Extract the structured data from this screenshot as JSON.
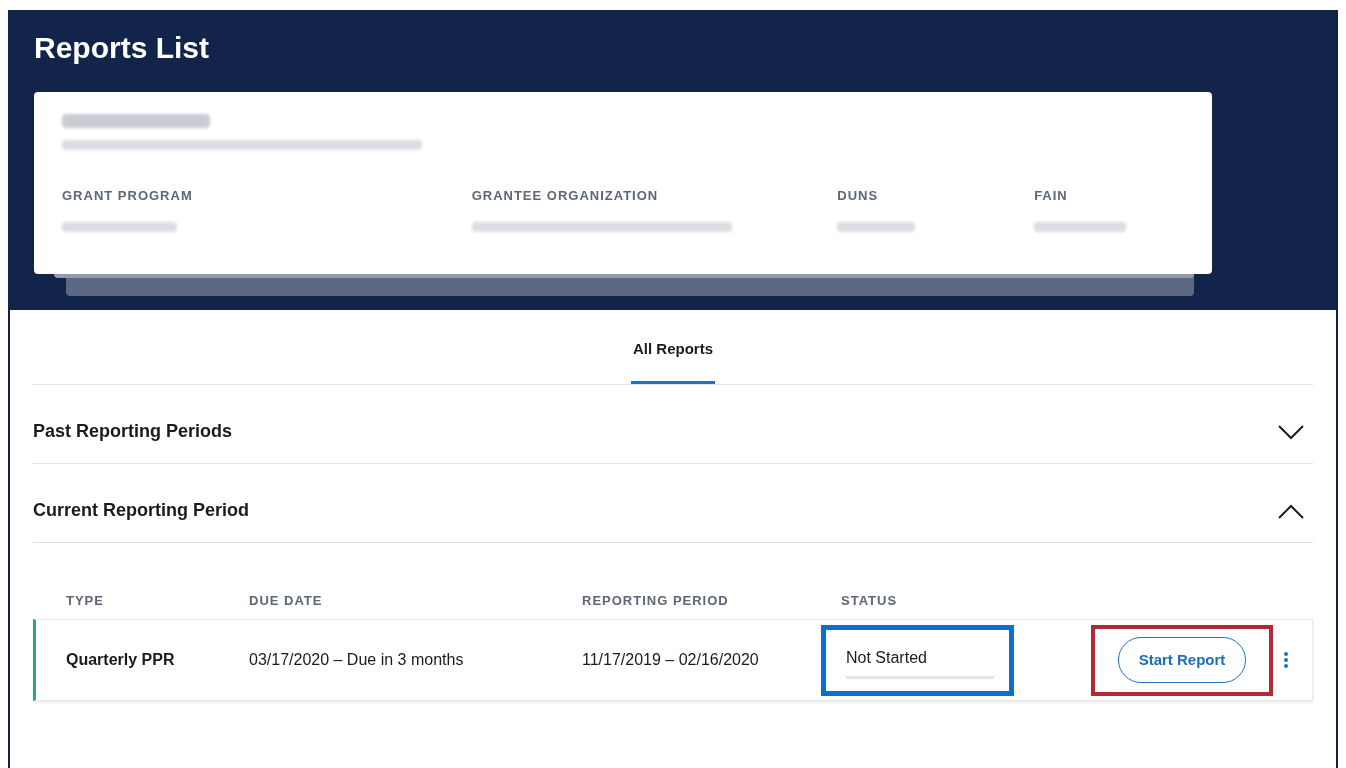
{
  "page": {
    "title": "Reports List"
  },
  "grant_card": {
    "fields": [
      {
        "label": "GRANT PROGRAM"
      },
      {
        "label": "GRANTEE ORGANIZATION"
      },
      {
        "label": "DUNS"
      },
      {
        "label": "FAIN"
      }
    ]
  },
  "tabs": [
    {
      "label": "All Reports",
      "selected": true
    }
  ],
  "sections": [
    {
      "title": "Past Reporting Periods",
      "expanded": false
    },
    {
      "title": "Current Reporting Period",
      "expanded": true
    }
  ],
  "table": {
    "columns": [
      "TYPE",
      "DUE DATE",
      "REPORTING PERIOD",
      "STATUS"
    ],
    "rows": [
      {
        "type": "Quarterly PPR",
        "due_date": "03/17/2020 – Due in 3 months",
        "reporting_period": "11/17/2019 – 02/16/2020",
        "status": "Not Started",
        "level": 0,
        "action": "Start Report"
      }
    ]
  }
}
